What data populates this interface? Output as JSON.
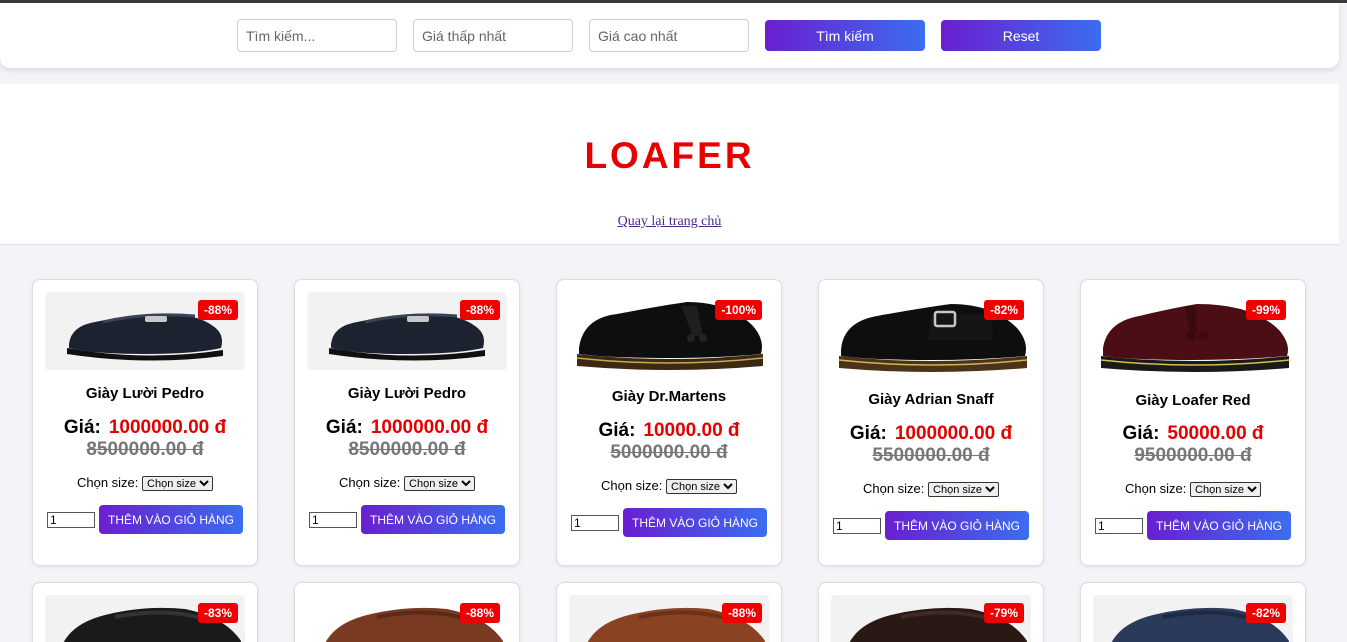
{
  "search": {
    "keyword_placeholder": "Tìm kiếm...",
    "min_price_placeholder": "Giá thấp nhất",
    "max_price_placeholder": "Giá cao nhất",
    "search_label": "Tìm kiếm",
    "reset_label": "Reset"
  },
  "hero": {
    "title": "LOAFER",
    "back_link": "Quay lại trang chủ"
  },
  "product_common": {
    "price_label": "Giá:",
    "size_label": "Chọn size:",
    "size_placeholder": "Chọn size",
    "qty_default": "1",
    "add_to_cart": "THÊM VÀO GIỎ HÀNG"
  },
  "products": [
    {
      "name": "Giày Lười Pedro",
      "price": "1000000.00 đ",
      "old_price": "8500000.00 đ",
      "discount": "-88%",
      "color": "#1c2230"
    },
    {
      "name": "Giày Lười Pedro",
      "price": "1000000.00 đ",
      "old_price": "8500000.00 đ",
      "discount": "-88%",
      "color": "#1c2230"
    },
    {
      "name": "Giày Dr.Martens",
      "price": "10000.00 đ",
      "old_price": "5000000.00 đ",
      "discount": "-100%",
      "color": "#0e0e0e"
    },
    {
      "name": "Giày Adrian Snaff",
      "price": "1000000.00 đ",
      "old_price": "5500000.00 đ",
      "discount": "-82%",
      "color": "#0e0e0e"
    },
    {
      "name": "Giày Loafer Red",
      "price": "50000.00 đ",
      "old_price": "9500000.00 đ",
      "discount": "-99%",
      "color": "#4a0e14"
    }
  ],
  "products_row2": [
    {
      "discount": "-83%",
      "color": "#1a1a1a"
    },
    {
      "discount": "-88%",
      "color": "#7a3a22"
    },
    {
      "discount": "-88%",
      "color": "#8a4322"
    },
    {
      "discount": "-79%",
      "color": "#2a1814"
    },
    {
      "discount": "-82%",
      "color": "#2b3a5a"
    }
  ]
}
